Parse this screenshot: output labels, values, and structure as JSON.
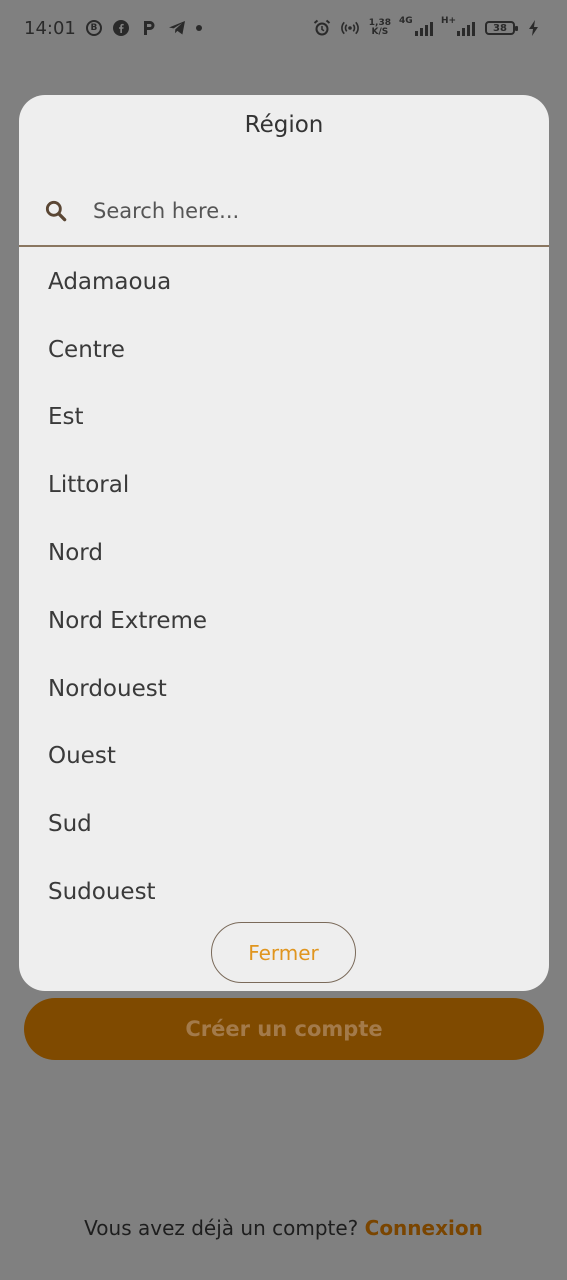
{
  "status_bar": {
    "time": "14:01",
    "left_icons": [
      "b-circle-icon",
      "facebook-icon",
      "p-icon",
      "telegram-icon",
      "dot-icon"
    ],
    "net_speed_value": "1,38",
    "net_speed_unit": "K/S",
    "network_labels": [
      "4G",
      "H+"
    ],
    "battery": "38"
  },
  "modal": {
    "title": "Région",
    "search": {
      "placeholder": "Search here..."
    },
    "regions": [
      "Adamaoua",
      "Centre",
      "Est",
      "Littoral",
      "Nord",
      "Nord Extreme",
      "Nordouest",
      "Ouest",
      "Sud",
      "Sudouest"
    ],
    "close_label": "Fermer"
  },
  "page": {
    "create_account_label": "Créer un compte",
    "login_prompt": "Vous avez déjà un compte?",
    "login_link": "Connexion"
  },
  "colors": {
    "overlay": "#808080",
    "modal_bg": "#eeeeee",
    "accent": "#e0951e",
    "primary_button": "#7f4a00"
  }
}
